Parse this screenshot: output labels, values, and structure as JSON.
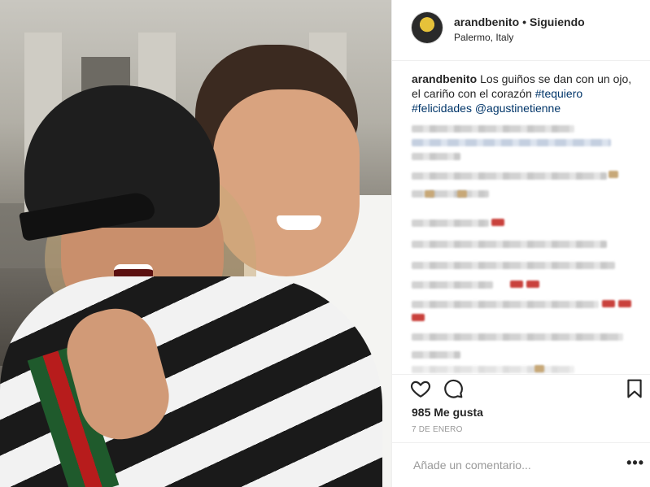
{
  "header": {
    "username": "arandbenito",
    "separator": "•",
    "follow_state": "Siguiendo",
    "location": "Palermo, Italy"
  },
  "caption": {
    "username": "arandbenito",
    "text": "Los guiños se dan con un ojo, el cariño con el corazón",
    "tags": [
      "#tequiero",
      "#felicidades",
      "@agustinetienne"
    ]
  },
  "icons": {
    "like": "heart-outline-icon",
    "comment": "speech-bubble-icon",
    "save": "bookmark-icon",
    "more": "more-horizontal-icon"
  },
  "stats": {
    "likes": "985 Me gusta",
    "date": "7 DE ENERO"
  },
  "comment": {
    "placeholder": "Añade un comentario...",
    "more_label": "•••"
  }
}
